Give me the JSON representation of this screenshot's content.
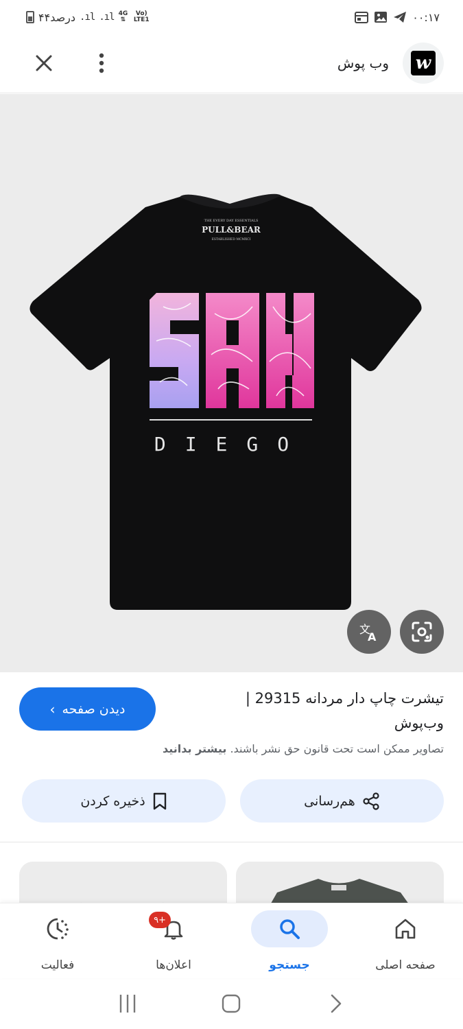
{
  "status_bar": {
    "time": "۰۰:۱۷",
    "battery": "۴۴درصد",
    "network_top": "4G",
    "network_bottom": "Vo) LTE1"
  },
  "header": {
    "site_name": "وب پوش",
    "logo_letter": "w",
    "icons": [
      "close-icon",
      "more-vert-icon"
    ]
  },
  "image": {
    "brand_small": "THE EVERY DAY ESSENTIALS",
    "brand_name": "PULL&BEAR",
    "brand_sub": "ESTABLISHED MCMXCI",
    "print_main": "SAN",
    "print_sub": "DIEGO",
    "colors": {
      "shirt": "#0f0f10",
      "pink": "#ec4aa8",
      "lavender": "#b6a4f0",
      "background": "#ececec"
    }
  },
  "info": {
    "title": "تیشرت چاپ دار مردانه 29315 | وب‌پوش",
    "view_button": "دیدن صفحه",
    "copyright_text": "تصاویر ممکن است تحت قانون حق نشر باشند.",
    "learn_more": "بیشتر بدانید",
    "share_label": "هم‌رسانی",
    "save_label": "ذخیره کردن"
  },
  "bottom_nav": {
    "home": "صفحه اصلی",
    "search": "جستجو",
    "notifications": "اعلان‌ها",
    "notifications_badge": "۹+",
    "activity": "فعالیت"
  },
  "accent_color": "#1a73e8"
}
